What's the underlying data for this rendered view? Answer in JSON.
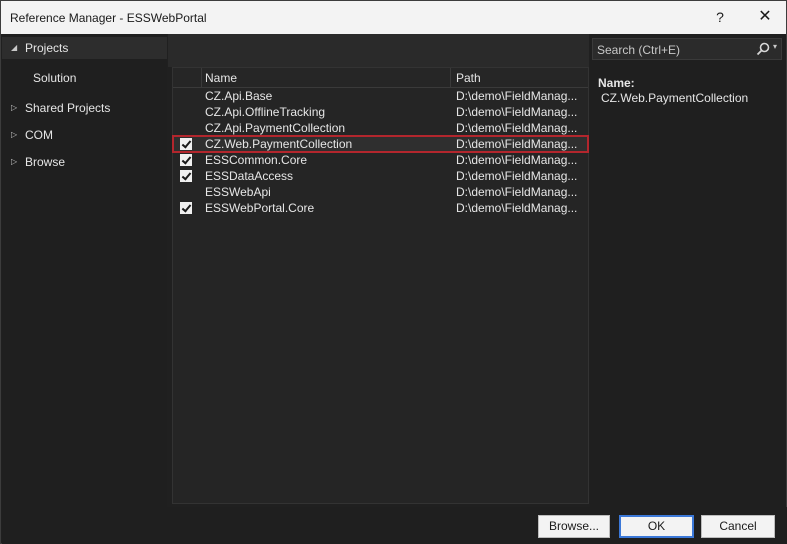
{
  "window": {
    "title": "Reference Manager - ESSWebPortal",
    "help_label": "?",
    "close_label": "✕"
  },
  "nav": {
    "items": [
      {
        "label": "Projects",
        "expander": "◢",
        "selected": true
      },
      {
        "label": "Solution",
        "expander": "",
        "child": true
      },
      {
        "label": "Shared Projects",
        "expander": "▷"
      },
      {
        "label": "COM",
        "expander": "▷"
      },
      {
        "label": "Browse",
        "expander": "▷"
      }
    ]
  },
  "grid": {
    "headers": {
      "name": "Name",
      "path": "Path"
    },
    "rows": [
      {
        "name": "CZ.Api.Base",
        "path": "D:\\demo\\FieldManag...",
        "checked": false
      },
      {
        "name": "CZ.Api.OfflineTracking",
        "path": "D:\\demo\\FieldManag...",
        "checked": false
      },
      {
        "name": "CZ.Api.PaymentCollection",
        "path": "D:\\demo\\FieldManag...",
        "checked": false
      },
      {
        "name": "CZ.Web.PaymentCollection",
        "path": "D:\\demo\\FieldManag...",
        "checked": true,
        "selected": true
      },
      {
        "name": "ESSCommon.Core",
        "path": "D:\\demo\\FieldManag...",
        "checked": true
      },
      {
        "name": "ESSDataAccess",
        "path": "D:\\demo\\FieldManag...",
        "checked": true
      },
      {
        "name": "ESSWebApi",
        "path": "D:\\demo\\FieldManag...",
        "checked": false
      },
      {
        "name": "ESSWebPortal.Core",
        "path": "D:\\demo\\FieldManag...",
        "checked": true
      }
    ]
  },
  "search": {
    "placeholder": "Search (Ctrl+E)",
    "icon": "search-icon",
    "dropdown": "▾"
  },
  "details": {
    "label": "Name:",
    "value": "CZ.Web.PaymentCollection"
  },
  "buttons": {
    "browse": "Browse...",
    "ok": "OK",
    "cancel": "Cancel"
  },
  "colors": {
    "selection_outline": "#b3262d",
    "ok_border": "#3b78d8"
  }
}
